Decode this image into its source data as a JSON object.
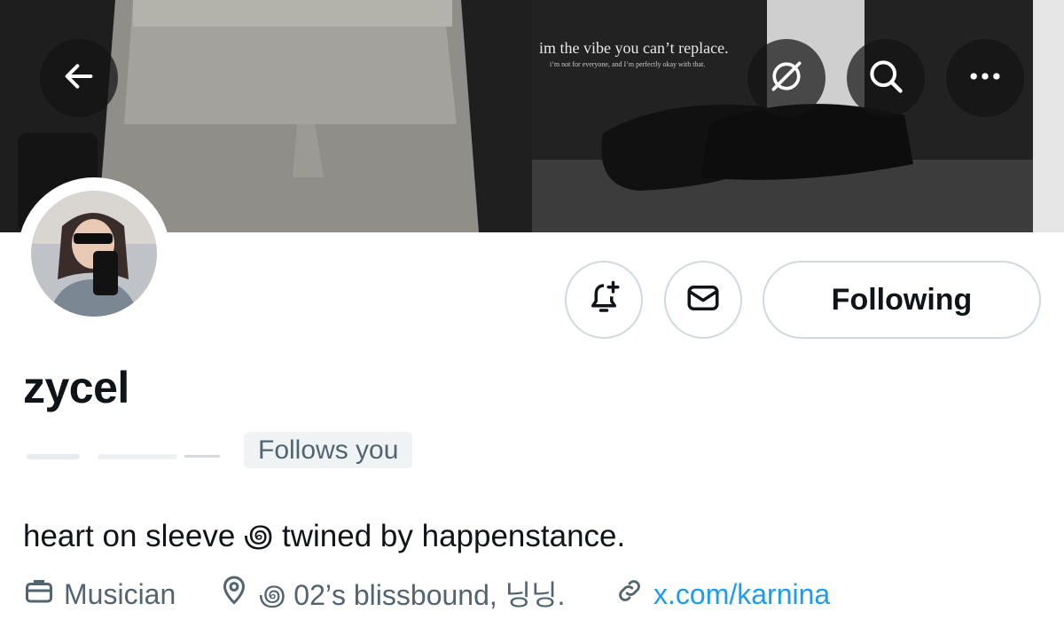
{
  "banner": {
    "quote_main": "im the vibe you can’t replace.",
    "quote_sub": "i’m not for everyone, and I’m perfectly okay with that."
  },
  "nav": {
    "back_icon": "arrow-left-icon",
    "translate_icon": "translate-slash-icon",
    "search_icon": "search-icon",
    "more_icon": "more-dots-icon"
  },
  "profile": {
    "display_name": "zycel",
    "follows_you": "Follows you",
    "bio": "heart on sleeve ꩜ twined by happenstance.",
    "job": "Musician",
    "location": "꩜ 02’s blissbound, 닝닝.",
    "link": "x.com/karnina"
  },
  "actions": {
    "following_label": "Following",
    "notify_icon": "bell-plus-icon",
    "message_icon": "envelope-icon"
  },
  "colors": {
    "link": "#1d9bf0",
    "secondary_text": "#536471",
    "border": "#cfd9de"
  }
}
